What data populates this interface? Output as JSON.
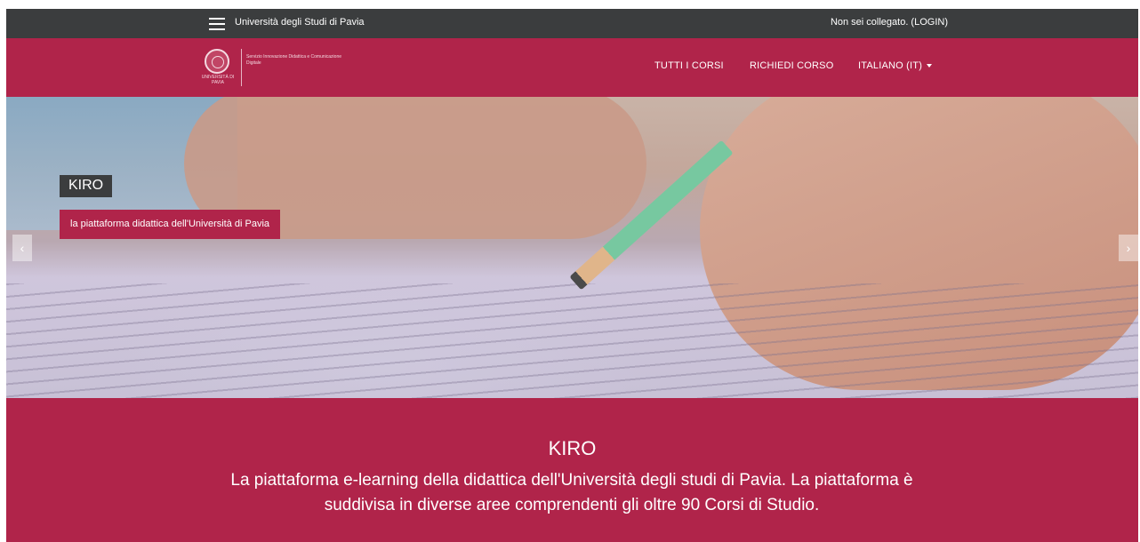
{
  "topbar": {
    "site_name": "Università degli Studi di Pavia",
    "login_status": "Non sei collegato. (LOGIN)",
    "menu_icon": "hamburger-menu-icon"
  },
  "navbar": {
    "logo": {
      "univ": "UNIVERSITÀ DI PAVIA",
      "dept": "Servizio Innovazione Didattica e Comunicazione Digitale"
    },
    "items": [
      {
        "label": "TUTTI I CORSI"
      },
      {
        "label": "RICHIEDI CORSO"
      },
      {
        "label": "ITALIANO (IT)"
      }
    ]
  },
  "hero": {
    "caption_title": "KIRO",
    "caption_text": "la piattaforma didattica dell'Università di Pavia",
    "prev_icon": "chevron-left-icon",
    "next_icon": "chevron-right-icon"
  },
  "intro": {
    "title": "KIRO",
    "text": "La piattaforma e-learning della didattica dell'Università degli studi di Pavia. La piattaforma è suddivisa in diverse aree comprendenti gli oltre 90 Corsi di Studio."
  },
  "colors": {
    "brand": "#b0244a",
    "topbar": "#3b3d3e"
  }
}
